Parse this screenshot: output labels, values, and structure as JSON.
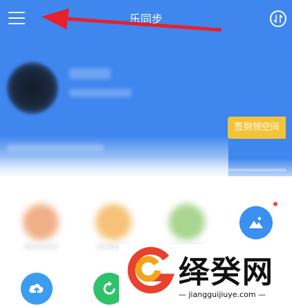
{
  "header": {
    "title": "乐同步"
  },
  "profile": {
    "sign_in_button": "签到领空间",
    "details_link": "查看详情"
  },
  "watermark": {
    "brand": "绎癸网",
    "url": "jiangguijiuye.com"
  },
  "colors": {
    "primary": "#3f86ee",
    "sign_in": "#f3c33a",
    "annotation_arrow": "#e8202a",
    "notification_dot": "#e94a3f"
  },
  "icons": [
    "menu-icon",
    "sync-icon",
    "album-icon",
    "cloud-upload-icon",
    "refresh-icon"
  ]
}
